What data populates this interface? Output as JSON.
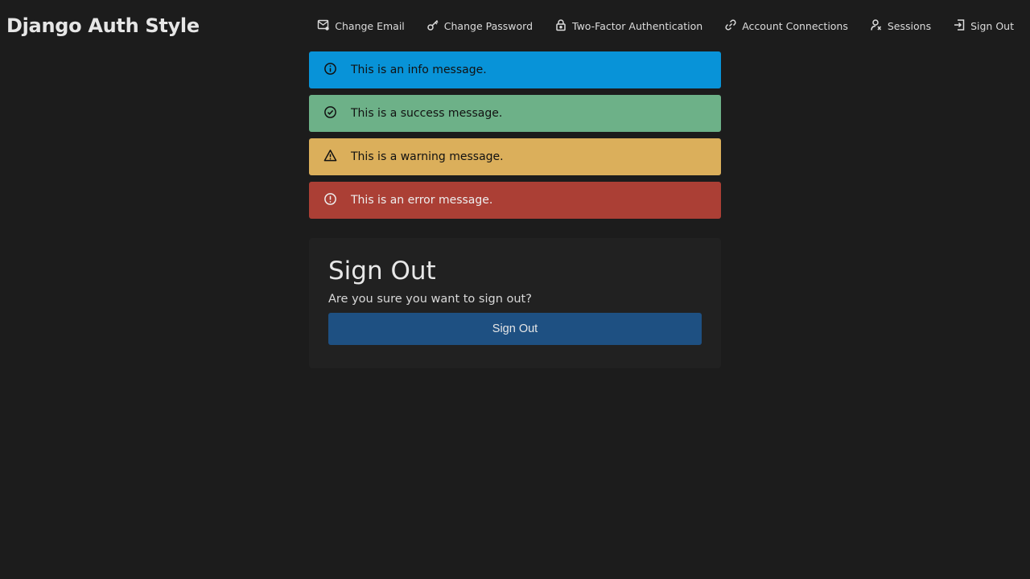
{
  "app": {
    "title": "Django Auth Style"
  },
  "nav": {
    "items": [
      {
        "label": "Change Email",
        "icon": "mail-icon"
      },
      {
        "label": "Change Password",
        "icon": "key-icon"
      },
      {
        "label": "Two-Factor Authentication",
        "icon": "lock-icon"
      },
      {
        "label": "Account Connections",
        "icon": "link-icon"
      },
      {
        "label": "Sessions",
        "icon": "user-sessions-icon"
      },
      {
        "label": "Sign Out",
        "icon": "sign-out-icon"
      }
    ]
  },
  "messages": [
    {
      "type": "info",
      "text": "This is an info message.",
      "icon": "info-icon",
      "color": "#0893d8",
      "text_color": "#111111"
    },
    {
      "type": "success",
      "text": "This is a success message.",
      "icon": "check-circle-icon",
      "color": "#6db188",
      "text_color": "#111111"
    },
    {
      "type": "warning",
      "text": "This is a warning message.",
      "icon": "warning-triangle-icon",
      "color": "#dbaf5b",
      "text_color": "#111111"
    },
    {
      "type": "error",
      "text": "This is an error message.",
      "icon": "error-circle-icon",
      "color": "#ab3f35",
      "text_color": "#eeeeee"
    }
  ],
  "card": {
    "title": "Sign Out",
    "description": "Are you sure you want to sign out?",
    "button_label": "Sign Out",
    "button_color": "#1e5082"
  }
}
